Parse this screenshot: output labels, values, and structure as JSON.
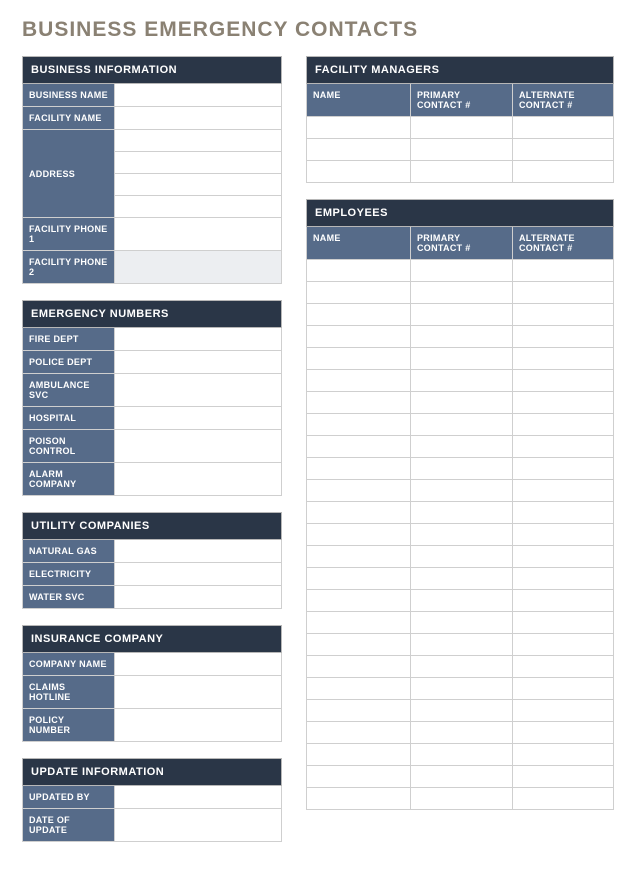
{
  "title": "BUSINESS EMERGENCY CONTACTS",
  "businessInfo": {
    "header": "BUSINESS INFORMATION",
    "labels": {
      "businessName": "BUSINESS NAME",
      "facilityName": "FACILITY NAME",
      "address": "ADDRESS",
      "phone1": "FACILITY PHONE 1",
      "phone2": "FACILITY PHONE 2"
    },
    "values": {
      "businessName": "",
      "facilityName": "",
      "addressLines": [
        "",
        "",
        "",
        ""
      ],
      "phone1": "",
      "phone2": ""
    }
  },
  "emergency": {
    "header": "EMERGENCY NUMBERS",
    "rows": [
      {
        "label": "FIRE DEPT",
        "value": ""
      },
      {
        "label": "POLICE DEPT",
        "value": ""
      },
      {
        "label": "AMBULANCE SVC",
        "value": ""
      },
      {
        "label": "HOSPITAL",
        "value": ""
      },
      {
        "label": "POISON CONTROL",
        "value": ""
      },
      {
        "label": "ALARM COMPANY",
        "value": ""
      }
    ]
  },
  "utility": {
    "header": "UTILITY COMPANIES",
    "rows": [
      {
        "label": "NATURAL GAS",
        "value": ""
      },
      {
        "label": "ELECTRICITY",
        "value": ""
      },
      {
        "label": "WATER SVC",
        "value": ""
      }
    ]
  },
  "insurance": {
    "header": "INSURANCE COMPANY",
    "rows": [
      {
        "label": "COMPANY NAME",
        "value": ""
      },
      {
        "label": "CLAIMS HOTLINE",
        "value": ""
      },
      {
        "label": "POLICY NUMBER",
        "value": ""
      }
    ]
  },
  "updateInfo": {
    "header": "UPDATE INFORMATION",
    "rows": [
      {
        "label": "UPDATED BY",
        "value": ""
      },
      {
        "label": "DATE OF UPDATE",
        "value": ""
      }
    ]
  },
  "facilityManagers": {
    "header": "FACILITY MANAGERS",
    "columns": {
      "name": "NAME",
      "primary": "PRIMARY CONTACT #",
      "alternate": "ALTERNATE CONTACT #"
    },
    "rows": [
      {
        "name": "",
        "primary": "",
        "alternate": ""
      },
      {
        "name": "",
        "primary": "",
        "alternate": ""
      },
      {
        "name": "",
        "primary": "",
        "alternate": ""
      }
    ]
  },
  "employees": {
    "header": "EMPLOYEES",
    "columns": {
      "name": "NAME",
      "primary": "PRIMARY CONTACT #",
      "alternate": "ALTERNATE CONTACT #"
    },
    "rowCount": 25
  }
}
